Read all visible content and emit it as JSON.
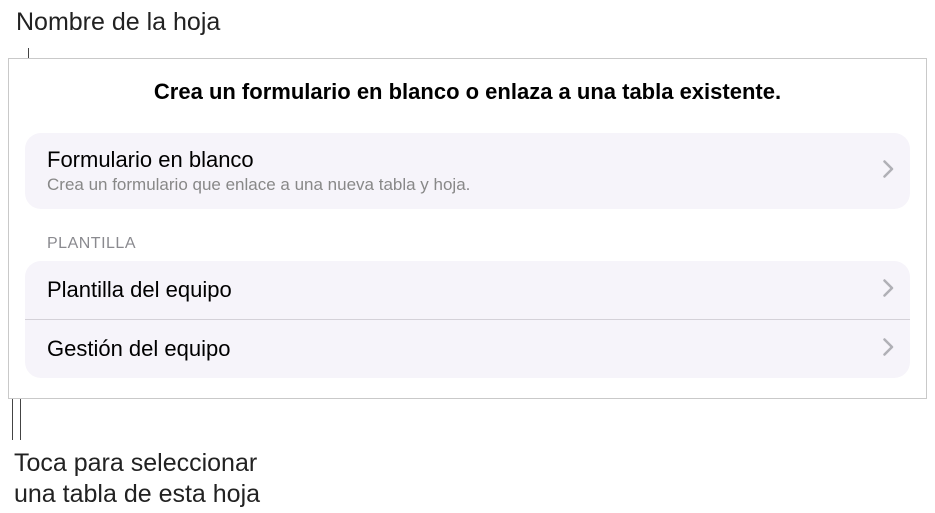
{
  "callouts": {
    "top": "Nombre de la hoja",
    "bottom_line1": "Toca para seleccionar",
    "bottom_line2": "una tabla de esta hoja"
  },
  "panel": {
    "title": "Crea un formulario en blanco o enlaza a una tabla existente.",
    "blank": {
      "title": "Formulario en blanco",
      "subtitle": "Crea un formulario que enlace a una nueva tabla y hoja."
    },
    "section_header": "PLANTILLA",
    "rows": [
      {
        "label": "Plantilla del equipo"
      },
      {
        "label": "Gestión del equipo"
      }
    ]
  }
}
